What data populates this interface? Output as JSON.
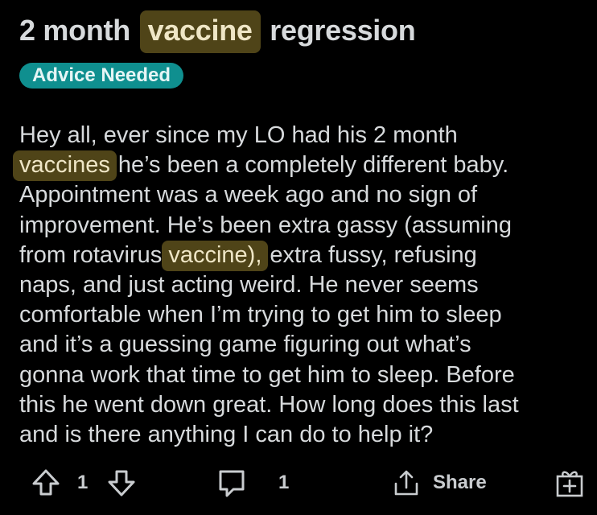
{
  "post": {
    "title_before": "2 month ",
    "title_highlight": "vaccine",
    "title_after": " regression",
    "flair": "Advice Needed",
    "body_lines": [
      {
        "before": "Hey all, ever since my LO had his 2 month",
        "highlight": "",
        "after": ""
      },
      {
        "before": "",
        "highlight": "vaccines",
        "after": " he’s been a completely different baby."
      },
      {
        "before": "Appointment was a week ago and no sign of",
        "highlight": "",
        "after": ""
      },
      {
        "before": "improvement. He’s been extra gassy (assuming",
        "highlight": "",
        "after": ""
      },
      {
        "before": "from rotavirus ",
        "highlight": "vaccine),",
        "after": " extra fussy, refusing"
      },
      {
        "before": "naps, and just acting weird. He never seems",
        "highlight": "",
        "after": ""
      },
      {
        "before": "comfortable when I’m trying to get him to sleep",
        "highlight": "",
        "after": ""
      },
      {
        "before": "and it’s a guessing game figuring out what’s",
        "highlight": "",
        "after": ""
      },
      {
        "before": "gonna work that time to get him to sleep. Before",
        "highlight": "",
        "after": ""
      },
      {
        "before": "this he went down great. How long does this last",
        "highlight": "",
        "after": ""
      },
      {
        "before": "and is there anything I can do to help it?",
        "highlight": "",
        "after": ""
      }
    ]
  },
  "actions": {
    "vote_count": "1",
    "comment_count": "1",
    "share_label": "Share"
  },
  "icons": {
    "upvote": "upvote-arrow-icon",
    "downvote": "downvote-arrow-icon",
    "comment": "comment-bubble-icon",
    "share": "share-upload-icon",
    "award": "gift-award-icon"
  },
  "colors": {
    "background": "#000000",
    "text": "#d7dadc",
    "highlight_bg": "#4f4418",
    "flair_bg": "#0f8f8f"
  }
}
